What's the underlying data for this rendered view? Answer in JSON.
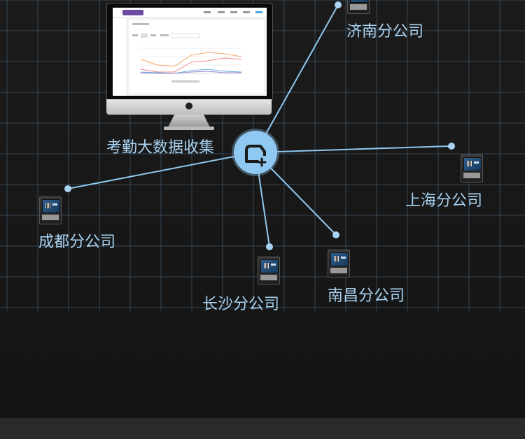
{
  "nodes": {
    "hub": {
      "label": "考勤大数据收集",
      "icon": "cloud-upload-icon"
    },
    "jinan": {
      "label": "济南分公司"
    },
    "shanghai": {
      "label": "上海分公司"
    },
    "chengdu": {
      "label": "成都分公司"
    },
    "changsha": {
      "label": "长沙分公司"
    },
    "nanchang": {
      "label": "南昌分公司"
    }
  },
  "colors": {
    "line": "#8fc8f0",
    "label": "#a9d3f2",
    "grid": "#4a6c86",
    "background": "#1a1a1a"
  }
}
